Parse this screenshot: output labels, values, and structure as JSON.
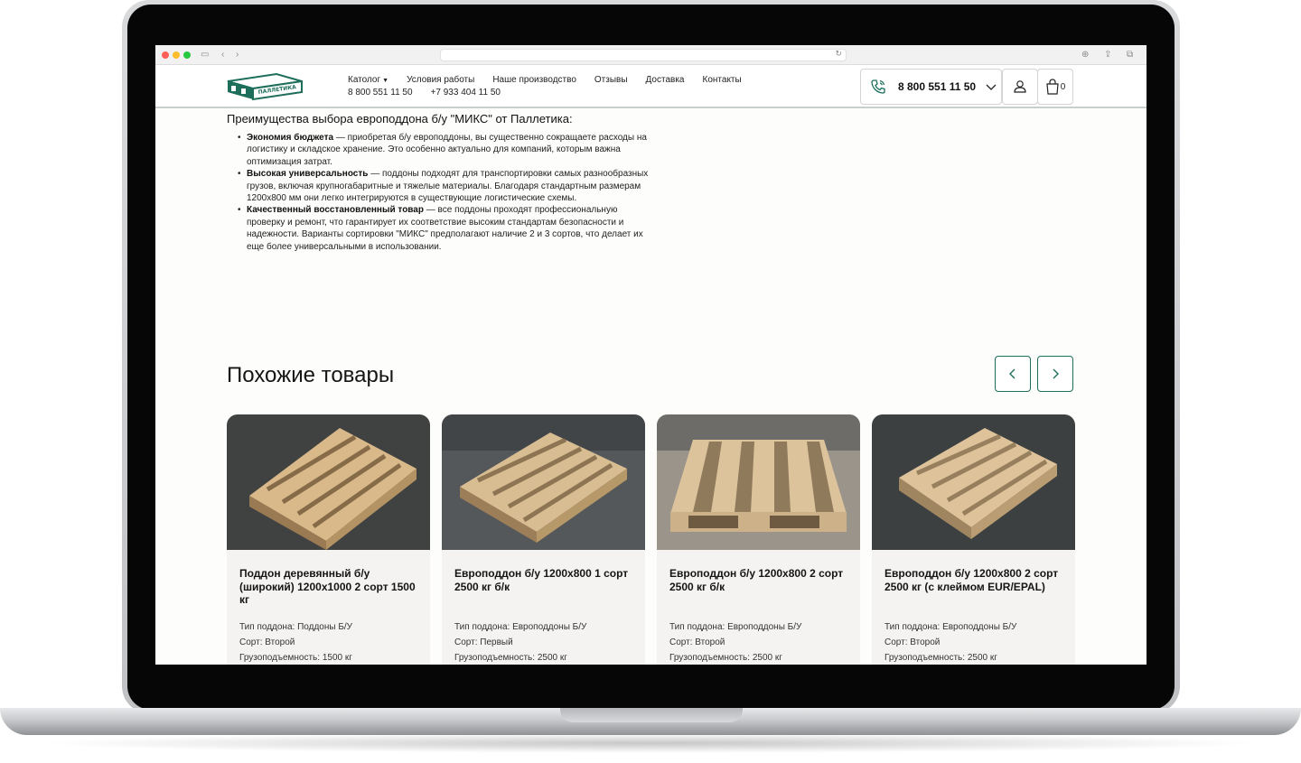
{
  "header": {
    "nav": [
      {
        "label": "Католог"
      },
      {
        "label": "Условия работы"
      },
      {
        "label": "Наше производство"
      },
      {
        "label": "Отзывы"
      },
      {
        "label": "Доставка"
      },
      {
        "label": "Контакты"
      }
    ],
    "phones": [
      "8 800 551 11 50",
      "+7 933 404 11 50"
    ],
    "main_phone": "8 800 551 11 50",
    "cart_count": "0",
    "logo_text": "ПАЛЛЕТИКА"
  },
  "article": {
    "title": "Преимущества выбора европоддона б/у \"МИКС\" от Паллетика:",
    "benefits": [
      {
        "bold": "Экономия бюджета",
        "text": " — приобретая б/у европоддоны, вы существенно сокращаете расходы на логистику и складское хранение. Это особенно актуально для компаний, которым важна оптимизация затрат."
      },
      {
        "bold": "Высокая универсальность",
        "text": " — поддоны подходят для транспортировки самых разнообразных грузов, включая крупногабаритные и тяжелые материалы. Благодаря стандартным размерам 1200х800 мм они легко интегрируются в существующие логистические схемы."
      },
      {
        "bold": "Качественный восстановленный товар",
        "text": " — все поддоны проходят профессиональную проверку и ремонт, что гарантирует их соответствие высоким стандартам безопасности и надежности. Варианты сортировки \"МИКС\" предполагают наличие 2 и 3 сортов, что делает их еще более универсальными в использовании."
      }
    ]
  },
  "similar": {
    "title": "Похожие товары",
    "products": [
      {
        "title": "Поддон деревянный б/у (широкий) 1200х1000 2 сорт 1500 кг",
        "type": "Тип поддона: Поддоны Б/У",
        "grade": "Сорт: Второй",
        "capacity": "Грузоподъемность: 1500 кг"
      },
      {
        "title": "Европоддон б/у 1200х800 1 сорт 2500 кг б/к",
        "type": "Тип поддона: Европоддоны Б/У",
        "grade": "Сорт: Первый",
        "capacity": "Грузоподъемность: 2500 кг"
      },
      {
        "title": "Европоддон б/у 1200х800 2 сорт 2500 кг б/к",
        "type": "Тип поддона: Европоддоны Б/У",
        "grade": "Сорт: Второй",
        "capacity": "Грузоподъемность: 2500 кг"
      },
      {
        "title": "Европоддон б/у 1200х800 2 сорт 2500 кг (с клеймом EUR/EPAL)",
        "type": "Тип поддона: Европоддоны Б/У",
        "grade": "Сорт: Второй",
        "capacity": "Грузоподъемность: 2500 кг"
      }
    ]
  },
  "colors": {
    "brand_green": "#1d6e5a",
    "card_bg": "#f4f3f1"
  }
}
